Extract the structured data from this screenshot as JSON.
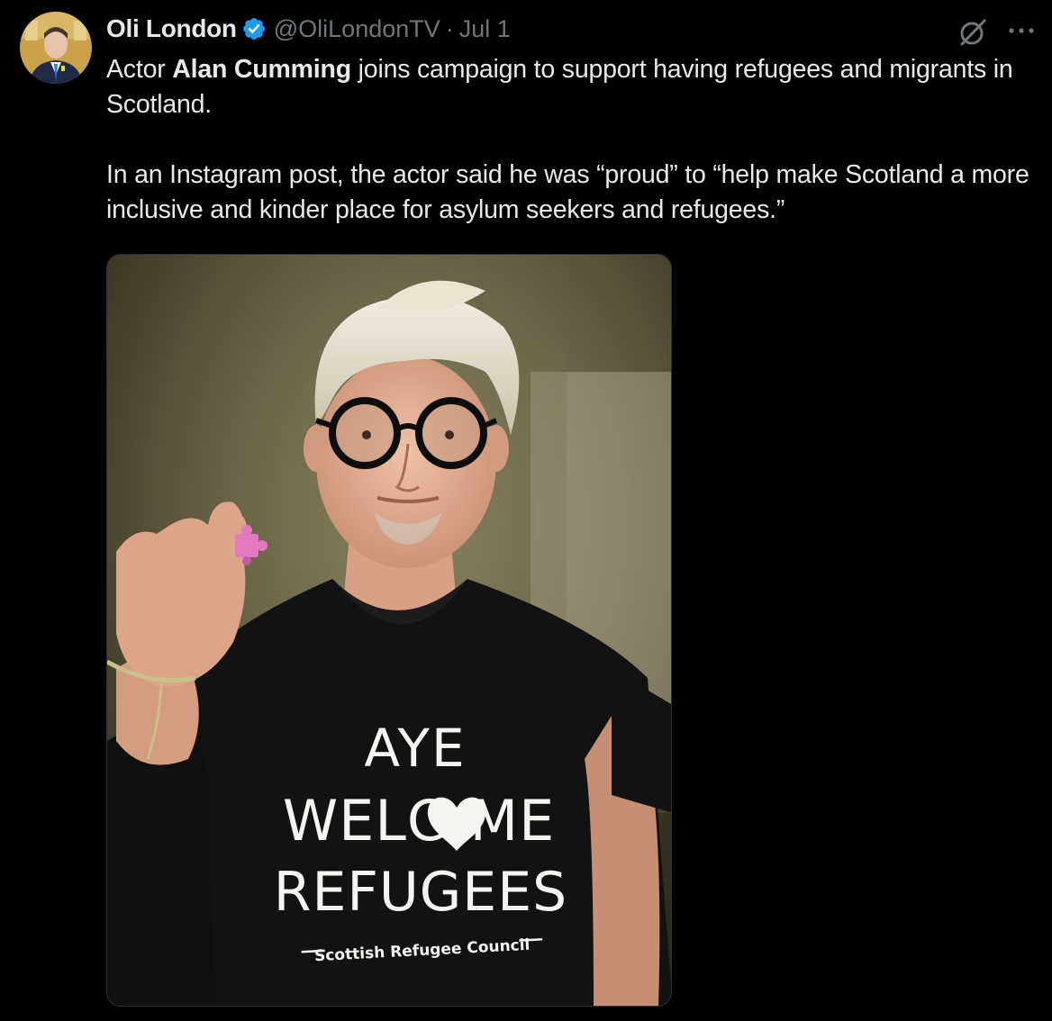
{
  "author": {
    "name": "Oli London",
    "handle": "@OliLondonTV",
    "separator": "·",
    "date": "Jul 1",
    "verified": true
  },
  "icons": {
    "avatar": "avatar",
    "verified": "verified-badge-icon",
    "grok": "grok-icon",
    "more": "more-options-icon"
  },
  "tweet": {
    "p1_before": "Actor ",
    "p1_bold": "Alan Cumming",
    "p1_after": " joins campaign to support having refugees and migrants in Scotland.",
    "p2": "In an Instagram post, the actor said he was “proud” to “help make Scotland a more inclusive and kinder place for asylum seekers and refugees.”"
  },
  "media": {
    "shirt_line1": "AYE",
    "shirt_line2_a": "WELC",
    "shirt_line2_b": "ME",
    "shirt_line3": "REFUGEES",
    "shirt_org": "Scottish Refugee Council"
  },
  "colors": {
    "background": "#000000",
    "text": "#e7e9ea",
    "secondary": "#71767b",
    "verified": "#1d9bf0"
  }
}
